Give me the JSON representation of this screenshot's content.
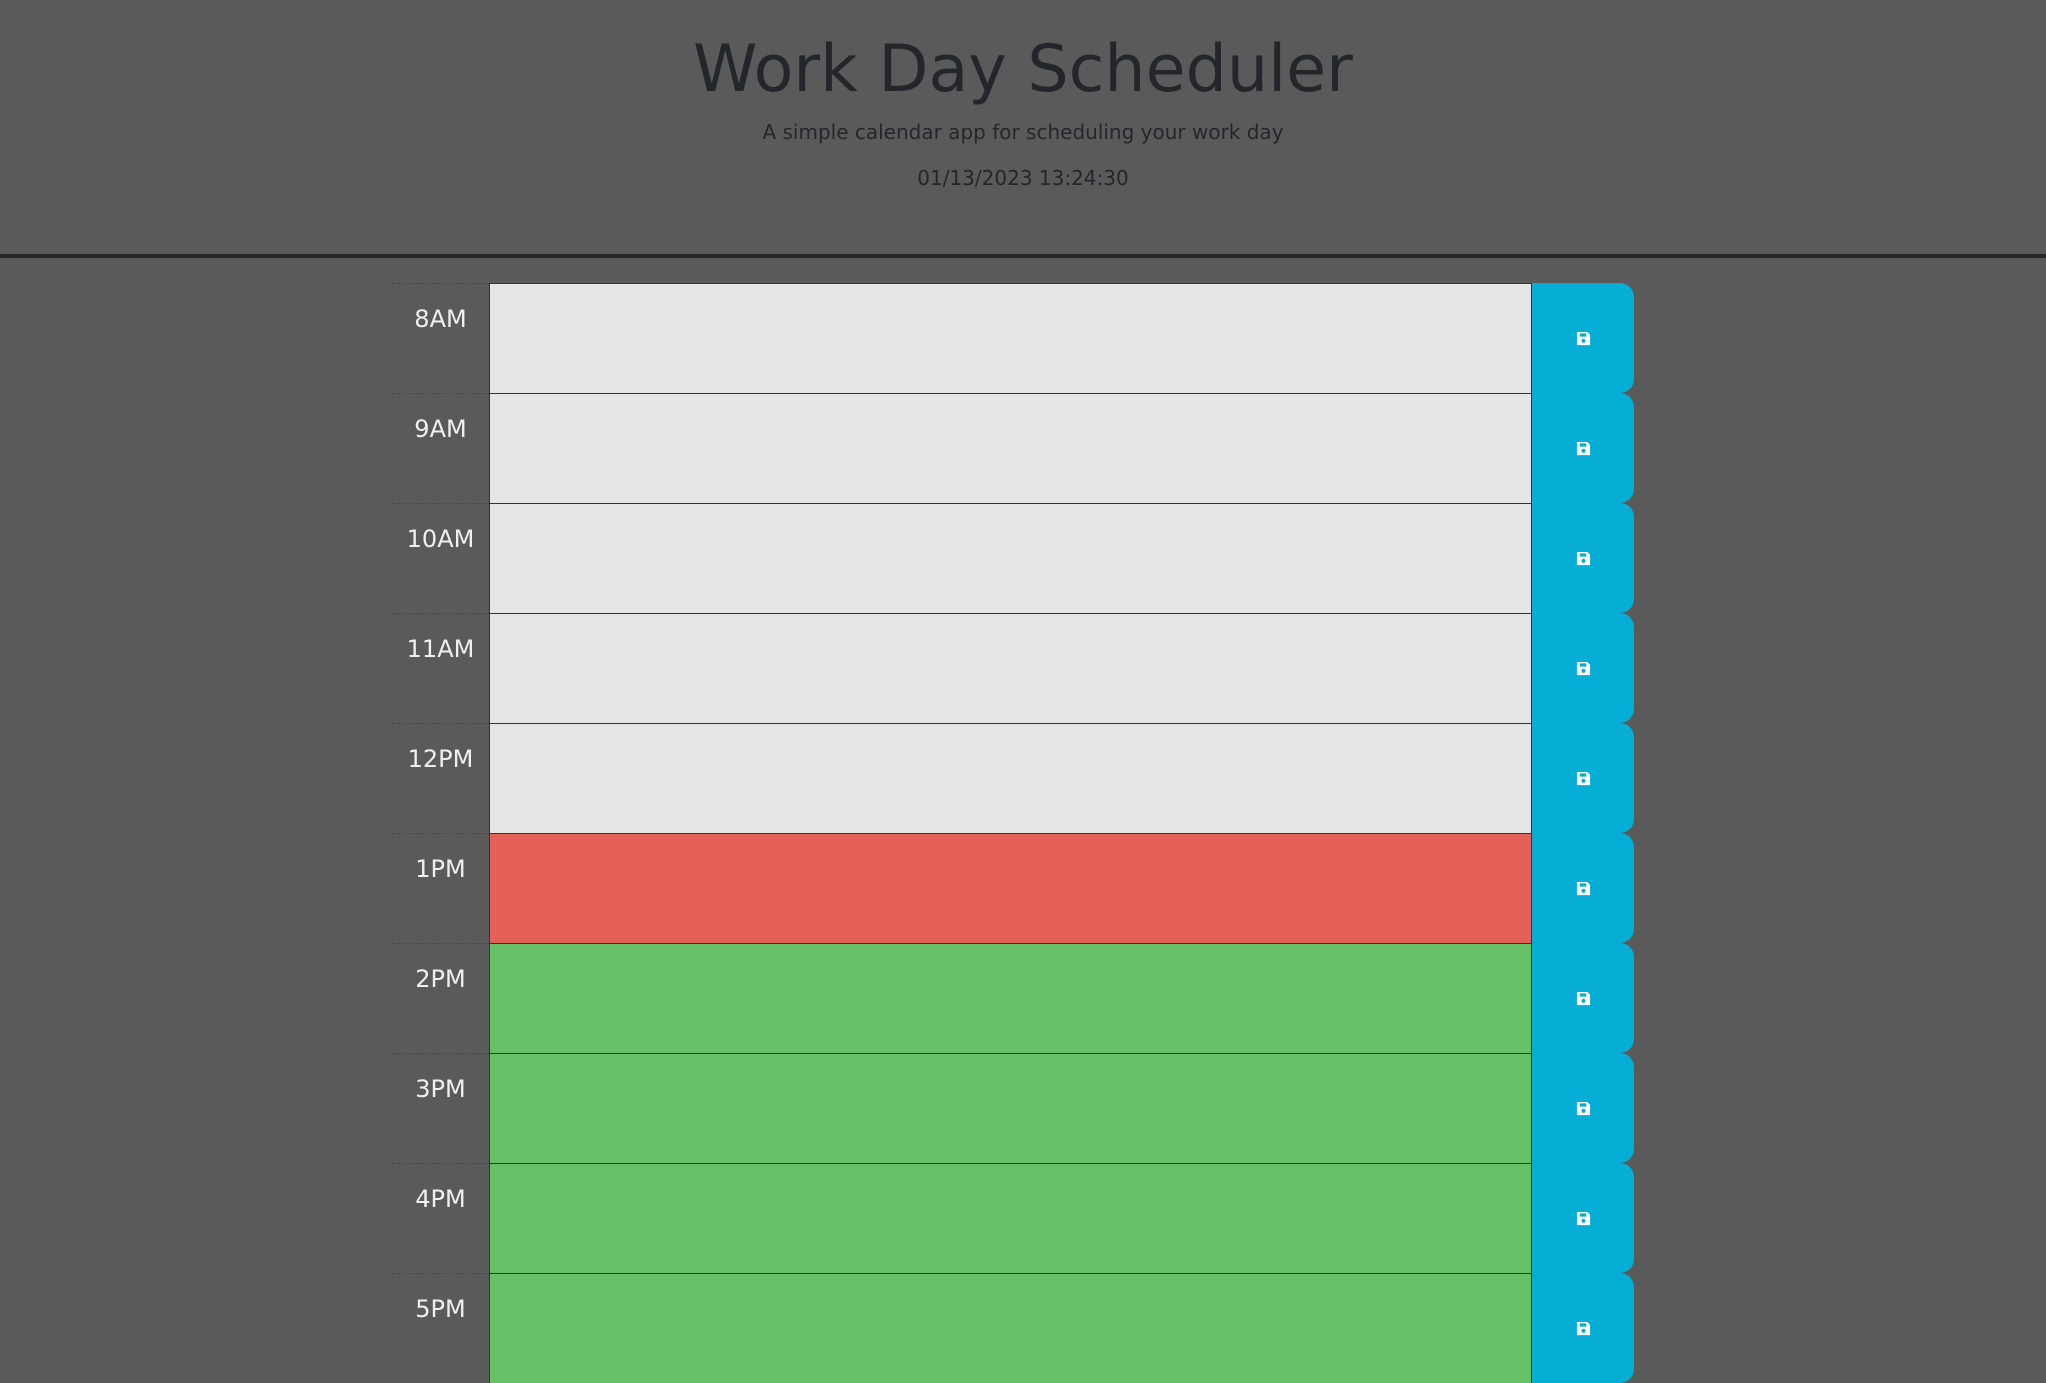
{
  "header": {
    "title": "Work Day Scheduler",
    "subtitle": "A simple calendar app for scheduling your work day",
    "current_datetime": "01/13/2023 13:24:30"
  },
  "colors": {
    "past": "#e6e6e6",
    "present": "#e6605a",
    "future": "#66c066",
    "save_button": "#06aed5"
  },
  "time_blocks": [
    {
      "hour": "8AM",
      "state": "past",
      "text": ""
    },
    {
      "hour": "9AM",
      "state": "past",
      "text": ""
    },
    {
      "hour": "10AM",
      "state": "past",
      "text": ""
    },
    {
      "hour": "11AM",
      "state": "past",
      "text": ""
    },
    {
      "hour": "12PM",
      "state": "past",
      "text": ""
    },
    {
      "hour": "1PM",
      "state": "present",
      "text": ""
    },
    {
      "hour": "2PM",
      "state": "future",
      "text": ""
    },
    {
      "hour": "3PM",
      "state": "future",
      "text": ""
    },
    {
      "hour": "4PM",
      "state": "future",
      "text": ""
    },
    {
      "hour": "5PM",
      "state": "future",
      "text": ""
    }
  ],
  "save_icon": "floppy-disk-icon"
}
